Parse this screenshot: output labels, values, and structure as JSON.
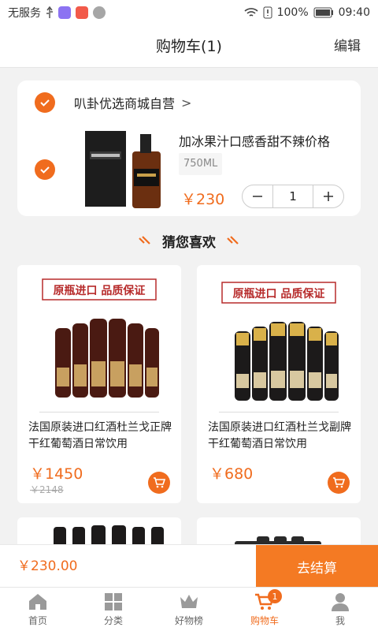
{
  "status_bar": {
    "carrier": "无服务",
    "battery": "100%",
    "time": "09:40"
  },
  "nav": {
    "title": "购物车(1)",
    "edit_label": "编辑"
  },
  "cart": {
    "store_name": "叭卦优选商城自营",
    "item": {
      "name": "加冰果汁口感香甜不辣价格",
      "spec": "750ML",
      "price": "￥230",
      "quantity": "1"
    }
  },
  "guess": {
    "heading": "猜您喜欢",
    "products": [
      {
        "banner": "原瓶进口 品质保证",
        "name": "法国原装进口红酒杜兰戈正牌干红葡萄酒日常饮用",
        "price": "￥1450",
        "original_price": "￥2148"
      },
      {
        "banner": "原瓶进口 品质保证",
        "name": "法国原装进口红酒杜兰戈副牌干红葡萄酒日常饮用",
        "price": "￥680",
        "original_price": ""
      }
    ]
  },
  "checkout": {
    "total": "￥230.00",
    "button_label": "去结算"
  },
  "tabbar": {
    "tabs": [
      {
        "label": "首页",
        "icon": "home-icon"
      },
      {
        "label": "分类",
        "icon": "category-icon"
      },
      {
        "label": "好物榜",
        "icon": "crown-icon"
      },
      {
        "label": "购物车",
        "icon": "cart-icon",
        "badge": "1"
      },
      {
        "label": "我",
        "icon": "user-icon"
      }
    ],
    "active_tab": "购物车"
  },
  "colors": {
    "accent": "#f06c1e",
    "checkout_button": "#f47a23"
  }
}
